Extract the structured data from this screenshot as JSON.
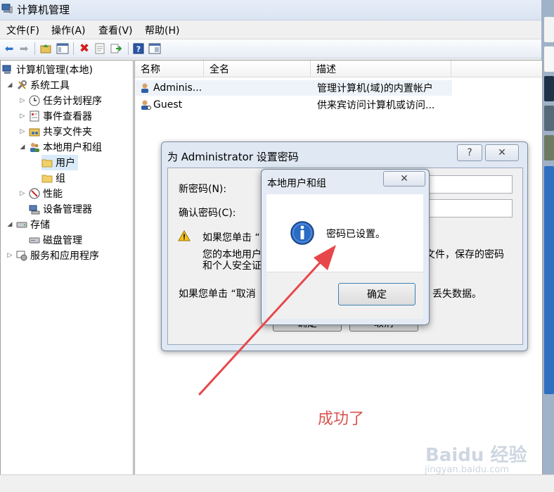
{
  "window": {
    "title": "计算机管理"
  },
  "menu": [
    "文件(F)",
    "操作(A)",
    "查看(V)",
    "帮助(H)"
  ],
  "toolbar": {
    "icons": [
      "back-icon",
      "forward-icon",
      "up-folder-icon",
      "show-hide-tree-icon",
      "delete-icon",
      "properties-icon",
      "export-icon",
      "help-icon",
      "view-icon"
    ]
  },
  "tree": [
    {
      "label": "计算机管理(本地)",
      "level": 0,
      "expander": ""
    },
    {
      "label": "系统工具",
      "level": 1,
      "expander": "◢"
    },
    {
      "label": "任务计划程序",
      "level": 2,
      "expander": "▷"
    },
    {
      "label": "事件查看器",
      "level": 2,
      "expander": "▷"
    },
    {
      "label": "共享文件夹",
      "level": 2,
      "expander": "▷"
    },
    {
      "label": "本地用户和组",
      "level": 2,
      "expander": "◢"
    },
    {
      "label": "用户",
      "level": 3,
      "expander": ""
    },
    {
      "label": "组",
      "level": 3,
      "expander": ""
    },
    {
      "label": "性能",
      "level": 2,
      "expander": "▷"
    },
    {
      "label": "设备管理器",
      "level": 2,
      "expander": ""
    },
    {
      "label": "存储",
      "level": 1,
      "expander": "◢"
    },
    {
      "label": "磁盘管理",
      "level": 2,
      "expander": ""
    },
    {
      "label": "服务和应用程序",
      "level": 1,
      "expander": "▷"
    }
  ],
  "list": {
    "columns": [
      "名称",
      "全名",
      "描述"
    ],
    "rows": [
      {
        "name": "Adminis...",
        "fullname": "",
        "desc": "管理计算机(域)的内置帐户"
      },
      {
        "name": "Guest",
        "fullname": "",
        "desc": "供来宾访问计算机或访问..."
      }
    ]
  },
  "pw_dialog": {
    "title": "为 Administrator 设置密码",
    "help": "?",
    "close": "✕",
    "new_label": "新密码(N):",
    "confirm_label": "确认密码(C):",
    "warn_1a": "如果您单击 “",
    "warn_2a": "您的本地用户",
    "warn_2b": "文件，保存的密码",
    "warn_3a": "和个人安全证",
    "cancel_note_a": "如果您单击 “取消",
    "cancel_note_b": "丢失数据。",
    "ok": "确定",
    "cancel": "取消"
  },
  "msg_dialog": {
    "title": "本地用户和组",
    "close": "✕",
    "message": "密码已设置。",
    "ok": "确定"
  },
  "annotation": "成功了",
  "watermark": {
    "line1": "Baidu 经验",
    "line2": "jingyan.baidu.com"
  },
  "colors": {
    "arrow": "#e8474a",
    "annotation": "#d9534f",
    "info": "#2b6bc4"
  }
}
